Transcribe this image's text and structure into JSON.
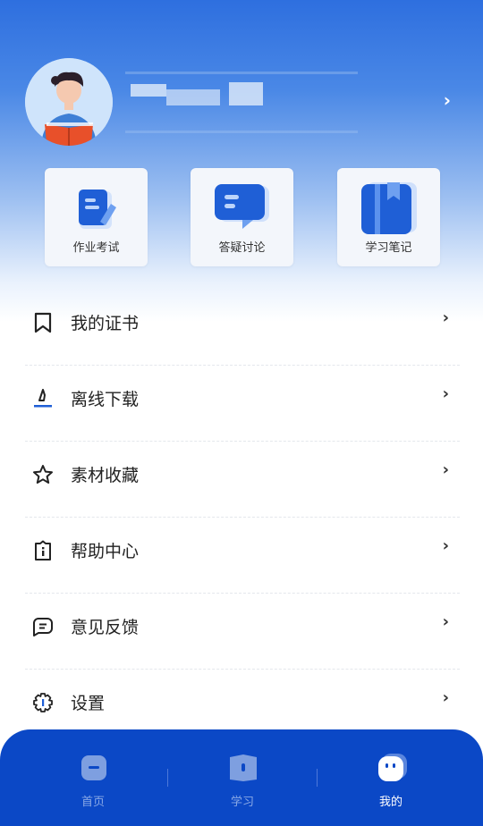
{
  "quick_actions": [
    {
      "label": "作业考试",
      "icon": "homework-exam-icon"
    },
    {
      "label": "答疑讨论",
      "icon": "qa-discussion-icon"
    },
    {
      "label": "学习笔记",
      "icon": "study-notes-icon"
    }
  ],
  "menu": [
    {
      "label": "我的证书",
      "icon": "bookmark-icon"
    },
    {
      "label": "离线下载",
      "icon": "download-icon"
    },
    {
      "label": "素材收藏",
      "icon": "star-icon"
    },
    {
      "label": "帮助中心",
      "icon": "info-icon"
    },
    {
      "label": "意见反馈",
      "icon": "feedback-icon"
    },
    {
      "label": "设置",
      "icon": "gear-icon"
    }
  ],
  "tabs": [
    {
      "label": "首页",
      "icon": "home-icon",
      "active": false
    },
    {
      "label": "学习",
      "icon": "book-icon",
      "active": false
    },
    {
      "label": "我的",
      "icon": "profile-face-icon",
      "active": true
    }
  ],
  "colors": {
    "accent": "#0b48c6",
    "header_top": "#2e6fdf"
  }
}
